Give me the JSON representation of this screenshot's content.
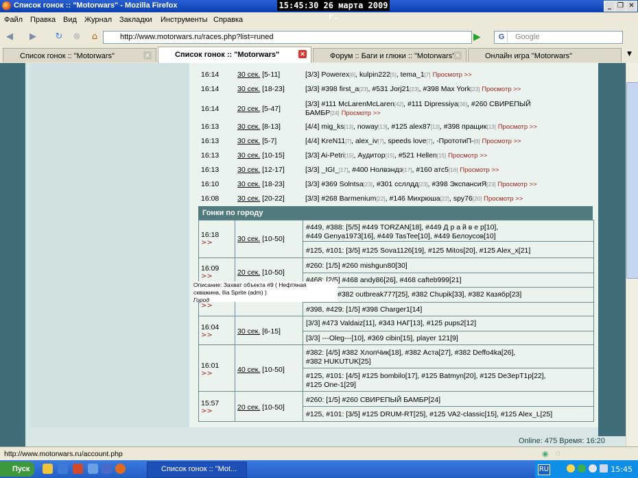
{
  "window": {
    "title": "Список гонок :: \"Motorwars\" - Mozilla Firefox",
    "clock": "15:45:30  26 марта 2009 г."
  },
  "menu": [
    "Файл",
    "Правка",
    "Вид",
    "Журнал",
    "Закладки",
    "Инструменты",
    "Справка"
  ],
  "nav": {
    "url": "http://www.motorwars.ru/races.php?list=runed",
    "search_placeholder": "Google"
  },
  "tabs": [
    {
      "label": "Список гонок :: \"Motorwars\"",
      "active": false
    },
    {
      "label": "Список гонок :: \"Motorwars\"",
      "active": true
    },
    {
      "label": "Форум :: Баги и глюки :: \"Motorwars\"",
      "active": false
    },
    {
      "label": "Онлайн игра \"Motorwars\"",
      "active": false
    }
  ],
  "races_top": [
    {
      "time": "16:14",
      "dur": "30 сек.",
      "range": "[5-11]",
      "count": "[3/3]",
      "entries": [
        [
          "Powerex",
          "[6]"
        ],
        [
          "kulpin222",
          "[5]"
        ],
        [
          "tema_1",
          "[7]"
        ]
      ],
      "view": "Просмотр >>"
    },
    {
      "time": "16:14",
      "dur": "30 сек.",
      "range": "[18-23]",
      "count": "[3/3]",
      "entries": [
        [
          "#398 first_a",
          "[23]"
        ],
        [
          "#531 Jorj21",
          "[23]"
        ],
        [
          "#398 Max York",
          "[23]"
        ]
      ],
      "view": "Просмотр >>"
    },
    {
      "time": "16:14",
      "dur": "20 сек.",
      "range": "[5-47]",
      "count": "[3/3]",
      "line1": [
        [
          "#111 McLarenMcLaren",
          "[42]"
        ],
        [
          "#111 Dipressiya",
          "[36]"
        ],
        [
          "#260 СВИРЕПЫЙ",
          ""
        ]
      ],
      "line2": [
        [
          "БАМБР",
          "[24]"
        ]
      ],
      "view": "Просмотр >>"
    },
    {
      "time": "16:13",
      "dur": "30 сек.",
      "range": "[8-13]",
      "count": "[4/4]",
      "entries": [
        [
          "mig_ks",
          "[13]"
        ],
        [
          "noway",
          "[13]"
        ],
        [
          "#125 alex87",
          "[13]"
        ],
        [
          "#398 пращик",
          "[13]"
        ]
      ],
      "view": "Просмотр >>"
    },
    {
      "time": "16:13",
      "dur": "30 сек.",
      "range": "[5-7]",
      "count": "[4/4]",
      "entries": [
        [
          "KreN11",
          "[7]"
        ],
        [
          "alex_iv",
          "[7]"
        ],
        [
          "speeds love",
          "[7]"
        ],
        [
          "-ПрототиП-",
          "[6]"
        ]
      ],
      "view": "Просмотр >>"
    },
    {
      "time": "16:13",
      "dur": "30 сек.",
      "range": "[10-15]",
      "count": "[3/3]",
      "entries": [
        [
          "Ai-Petri",
          "[15]"
        ],
        [
          "Аудитор",
          "[15]"
        ],
        [
          "#521 Hellen",
          "[15]"
        ]
      ],
      "view": "Просмотр >>"
    },
    {
      "time": "16:13",
      "dur": "30 сек.",
      "range": "[12-17]",
      "count": "[3/3]",
      "entries": [
        [
          "_IGI_",
          "[17]"
        ],
        [
          "#400 Нолвэндэ",
          "[17]"
        ],
        [
          "#160 атс5",
          "[16]"
        ]
      ],
      "view": "Просмотр >>"
    },
    {
      "time": "16:10",
      "dur": "30 сек.",
      "range": "[18-23]",
      "count": "[3/3]",
      "entries": [
        [
          "#369 Solntsa",
          "[23]"
        ],
        [
          "#301 ссллдд",
          "[23]"
        ],
        [
          "#398 ЭкспансиЯ",
          "[23]"
        ]
      ],
      "view": "Просмотр >>"
    },
    {
      "time": "16:08",
      "dur": "30 сек.",
      "range": "[20-22]",
      "count": "[3/3]",
      "entries": [
        [
          "#268 Barmenium",
          "[22]"
        ],
        [
          "#146 Михрюша",
          "[22]"
        ],
        [
          "spy76",
          "[20]"
        ]
      ],
      "view": "Просмотр >>"
    }
  ],
  "section_title": "Гонки по городу",
  "city": {
    "r1": {
      "time": "16:18",
      "arrow": ">>",
      "dur": "30 сек.",
      "range": "[10-50]",
      "t1a": "#449, #388: [5/5] #449 TORZAN[18], #449 Д р а й в е р[10],",
      "t1b": "#449 Genya1973[16], #449 TasTee[10], #449 Белоусов[10]",
      "t2": "#125, #101: [3/5] #125 Sova1126[19], #125 Mitos[20], #125 Alex_x[21]"
    },
    "r2": {
      "time": "16:09",
      "arrow": ">>",
      "dur": "20 сек.",
      "range": "[10-50]",
      "t1": "#260: [1/5] #260 mishgun80[30]",
      "t2": "#468: [2/5] #468 andy86[26], #468 cafteb999[21]",
      "t3": "#382 outbreak777[25], #382 Chupik[33], #382 Казябр[23]",
      "t4": "#398, #429: [1/5] #398 Charger1[14]",
      "arrow2": ">>"
    },
    "r3": {
      "time": "16:04",
      "arrow": ">>",
      "dur": "30 сек.",
      "range": "[6-15]",
      "t1": "[3/3] #473 Valdaiz[11], #343 НАГ[13], #125 pups2[12]",
      "t2": "[3/3] ---Oleg---[10], #369 cibin[15], player 121[9]"
    },
    "r4": {
      "time": "16:01",
      "arrow": ">>",
      "dur": "40 сек.",
      "range": "[10-50]",
      "t1a": "#382: [4/5] #382 ХлопЧик[18], #382 Аста[27], #382 Deffo4ka[26],",
      "t1b": "#382 HUKUTUK[25]",
      "t2a": "#125, #101: [4/5] #125 bombilo[17], #125 Batmyn[20], #125 DeЗерТ1р[22],",
      "t2b": "#125 One-1[29]"
    },
    "r5": {
      "time": "15:57",
      "arrow": ">>",
      "dur": "20 сек.",
      "range": "[10-50]",
      "t1": "#260: [1/5] #260 СВИРЕПЫЙ БАМБР[24]",
      "t2": "#125, #101: [3/5] #125 DRUM-RT[25], #125 VA2-classic[15], #125 Alex_L[25]"
    }
  },
  "tooltip": {
    "l1": "Описание: Захват объекта #9 ( Нефтяная",
    "l2": "скважина, Ilia Sprite (adm) )",
    "l3": "Город"
  },
  "footer": "Online: 475  Время: 16:20",
  "status_url": "http://www.motorwars.ru/account.php",
  "taskbar": {
    "start": "Пуск",
    "item": "Список гонок :: \"Mot...",
    "lang": "RU",
    "time": "15:45"
  }
}
